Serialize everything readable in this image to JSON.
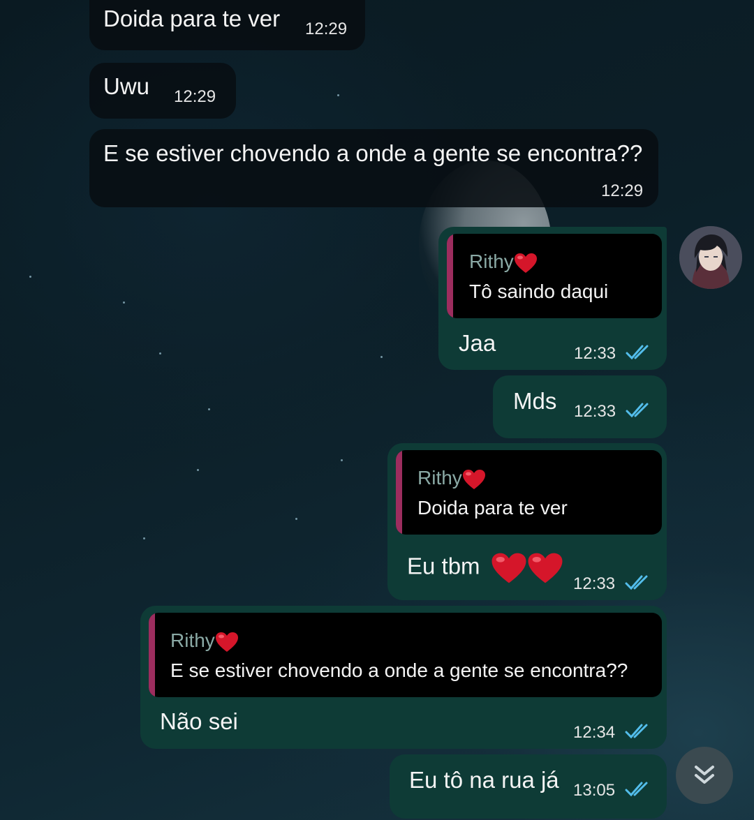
{
  "incoming": [
    {
      "text": "Doida para te ver",
      "time": "12:29"
    },
    {
      "text": "Uwu",
      "time": "12:29"
    },
    {
      "text": "E se estiver chovendo a onde a gente se encontra??",
      "time": "12:29"
    }
  ],
  "outgoing": [
    {
      "reply": {
        "name": "Rithy",
        "text": "Tô saindo daqui"
      },
      "text": "Jaa",
      "time": "12:33"
    },
    {
      "text": "Mds",
      "time": "12:33"
    },
    {
      "reply": {
        "name": "Rithy",
        "text": "Doida para te ver"
      },
      "text": "Eu tbm",
      "emoji": "heart-heart",
      "time": "12:33"
    },
    {
      "reply": {
        "name": "Rithy",
        "text": "E se estiver chovendo a onde a gente se encontra??"
      },
      "text": "Não sei",
      "time": "12:34"
    },
    {
      "text": "Eu tô na rua já",
      "time": "13:05"
    }
  ],
  "colors": {
    "outgoing_bubble": "#0e3b36",
    "incoming_bubble": "#080e12",
    "quote_bar": "#9c2d5e",
    "quote_name": "#8aa9a5",
    "read_ticks": "#53bdeb"
  },
  "icons": {
    "read_receipt": "double-check-icon",
    "scroll_down": "double-chevron-down-icon",
    "heart": "red-heart-emoji"
  }
}
